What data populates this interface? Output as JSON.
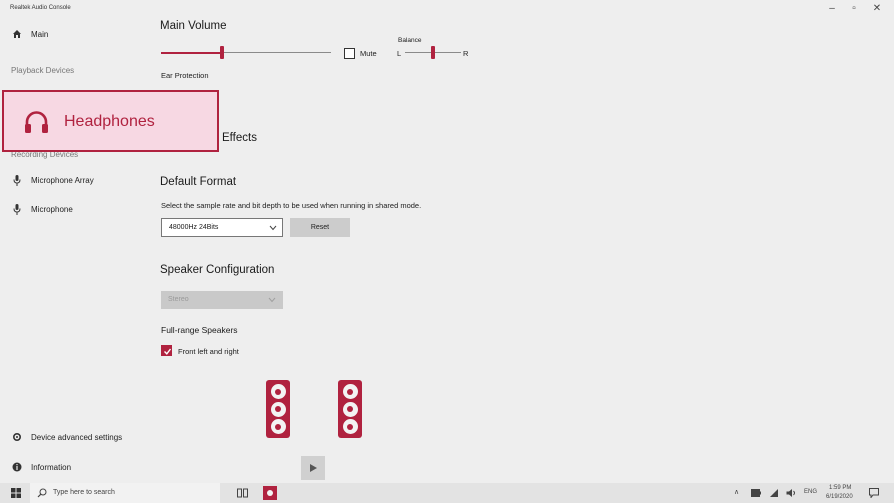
{
  "app": {
    "title": "Realtek Audio Console",
    "window_controls": [
      "–",
      "▫",
      "✕"
    ]
  },
  "sidebar": {
    "main_label": "Main",
    "playback_header": "Playback Devices",
    "selected_device": "Headphones",
    "recording_header": "Recording Devices",
    "recording_items": [
      "Microphone Array",
      "Microphone"
    ],
    "device_advanced_settings": "Device advanced settings",
    "information": "Information"
  },
  "main": {
    "volume_title": "Main Volume",
    "volume_level": 0.36,
    "mute_label": "Mute",
    "mute_checked": false,
    "balance_label": "Balance",
    "balance_left": "L",
    "balance_right": "R",
    "balance_level": 0.5,
    "ear_protection_label": "Ear Protection",
    "sound_effects_partial": "Effects",
    "default_format_title": "Default Format",
    "default_format_desc": "Select the sample rate and bit depth to be used when running in shared mode.",
    "format_value": "48000Hz 24Bits",
    "reset_label": "Reset",
    "speaker_config_title": "Speaker Configuration",
    "speaker_config_value": "Stereo",
    "full_range_title": "Full-range Speakers",
    "front_lr_label": "Front left and right",
    "front_lr_checked": true
  },
  "taskbar": {
    "search_placeholder": "Type here to search",
    "time": "1:59 PM",
    "date": "6/19/2020",
    "lang": "ENG"
  },
  "colors": {
    "accent": "#b0223f",
    "highlight_bg": "#f7d8e3"
  }
}
